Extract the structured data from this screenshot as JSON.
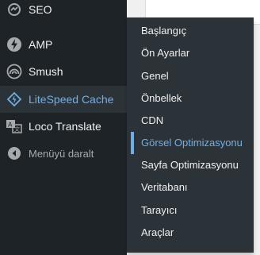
{
  "menu": {
    "items": [
      {
        "label": "SEO",
        "icon": "seo-icon"
      },
      {
        "label": "AMP",
        "icon": "amp-lightning-icon"
      },
      {
        "label": "Smush",
        "icon": "smush-icon"
      },
      {
        "label": "LiteSpeed Cache",
        "icon": "litespeed-diamond-icon"
      },
      {
        "label": "Loco Translate",
        "icon": "translate-icon"
      }
    ],
    "collapse_label": "Menüyü daralt",
    "collapse_icon": "collapse-arrow-icon"
  },
  "submenu": {
    "items": [
      "Başlangıç",
      "Ön Ayarlar",
      "Genel",
      "Önbellek",
      "CDN",
      "Görsel Optimizasyonu",
      "Sayfa Optimizasyonu",
      "Veritabanı",
      "Tarayıcı",
      "Araçlar"
    ],
    "current_index": 5
  },
  "colors": {
    "sidebar_bg": "#1d2327",
    "submenu_bg": "#2c3338",
    "text": "#f0f0f1",
    "accent": "#72aee6",
    "muted": "#a7aaad"
  }
}
